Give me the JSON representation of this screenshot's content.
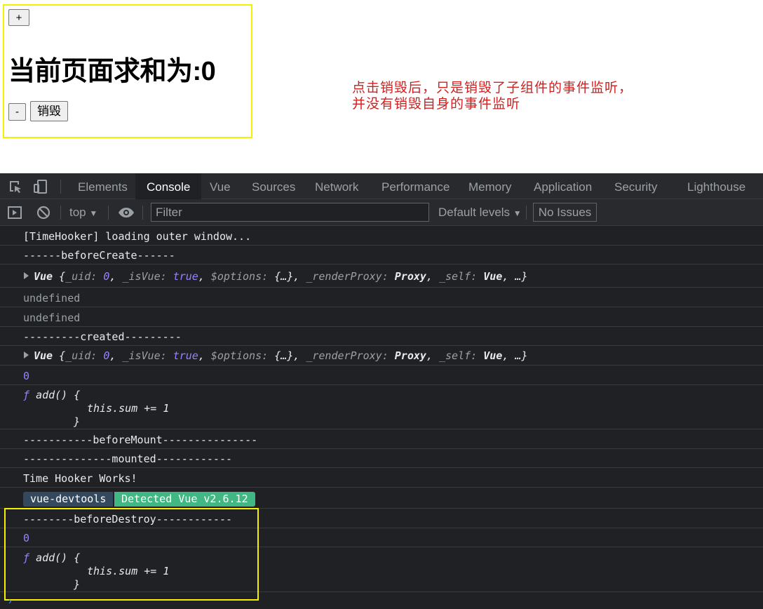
{
  "app": {
    "plus_label": "+",
    "sum_title": "当前页面求和为:0",
    "minus_label": "-",
    "destroy_label": "销毁"
  },
  "annotation": {
    "line1": "点击销毁后，只是销毁了子组件的事件监听，",
    "line2": "并没有销毁自身的事件监听",
    "color": "#d2201f"
  },
  "devtools": {
    "tabs": [
      "Elements",
      "Console",
      "Vue",
      "Sources",
      "Network",
      "Performance",
      "Memory",
      "Application",
      "Security",
      "Lighthouse"
    ],
    "active_tab": "Console",
    "toolbar": {
      "context": "top",
      "filter_placeholder": "Filter",
      "levels": "Default levels",
      "issues": "No Issues"
    },
    "console": {
      "r1": "[TimeHooker] loading outer window...",
      "r2": "------beforeCreate------",
      "obj": {
        "name": "Vue",
        "open": "{",
        "uid_key": "_uid:",
        "uid_val": "0",
        "isvue_key": "_isVue:",
        "isvue_val": "true",
        "options_key": "$options:",
        "options_val": "{…}",
        "proxy_key": "_renderProxy:",
        "proxy_val": "Proxy",
        "self_key": "_self:",
        "self_val": "Vue",
        "close": "…}"
      },
      "r4": "undefined",
      "r5": "undefined",
      "r6": "---------created---------",
      "r8": "0",
      "fn_keyword": "ƒ",
      "fn_sig": "add() {",
      "fn_body": "this.sum += 1",
      "fn_close": "}",
      "r10": "-----------beforeMount---------------",
      "r11": "--------------mounted------------",
      "r12": "Time Hooker Works!",
      "badge_left": "vue-devtools",
      "badge_right": "Detected Vue v2.6.12",
      "r14": "--------beforeDestroy------------",
      "r15": "0"
    }
  }
}
